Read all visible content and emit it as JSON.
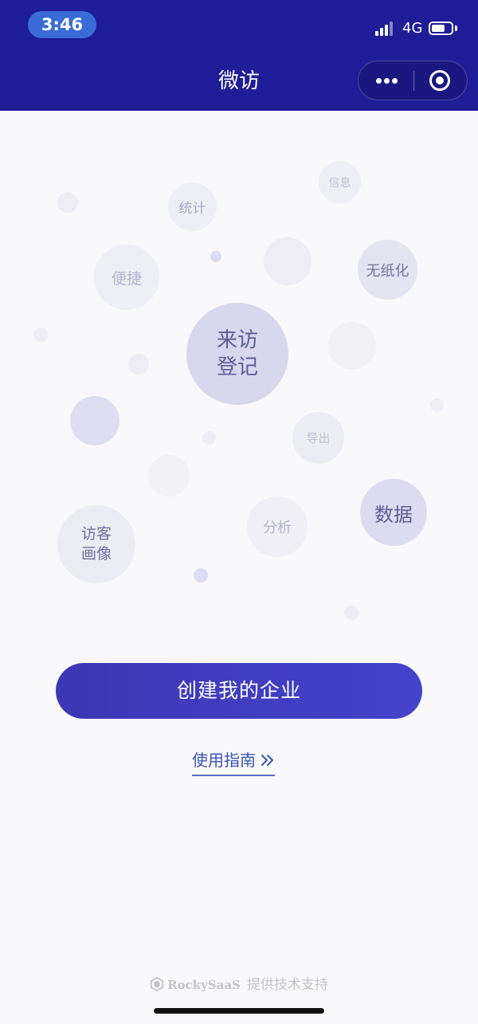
{
  "status_bar": {
    "time": "3:46",
    "network": "4G",
    "icons": [
      "signal-icon",
      "battery-icon"
    ]
  },
  "header": {
    "title": "微访",
    "capsule_icons": [
      "more-dots-icon",
      "close-target-icon"
    ]
  },
  "bubbles": {
    "visitor_registration": [
      "来访",
      "登记"
    ],
    "statistics": "统计",
    "information": "信息",
    "convenient": "便捷",
    "paperless": "无纸化",
    "export": "导出",
    "data": "数据",
    "analysis": "分析",
    "visitor_profile": [
      "访客",
      "画像"
    ]
  },
  "actions": {
    "create_enterprise": "创建我的企业",
    "user_guide": "使用指南",
    "guide_arrow_icon": "double-chevron-right-icon"
  },
  "footer": {
    "brand": "RockySaaS",
    "text": "提供技术支持",
    "logo_icon": "rockysaas-logo-icon"
  },
  "colors": {
    "header_bg": "#1e1c96",
    "accent": "#4443cc",
    "link": "#3b52b5"
  }
}
